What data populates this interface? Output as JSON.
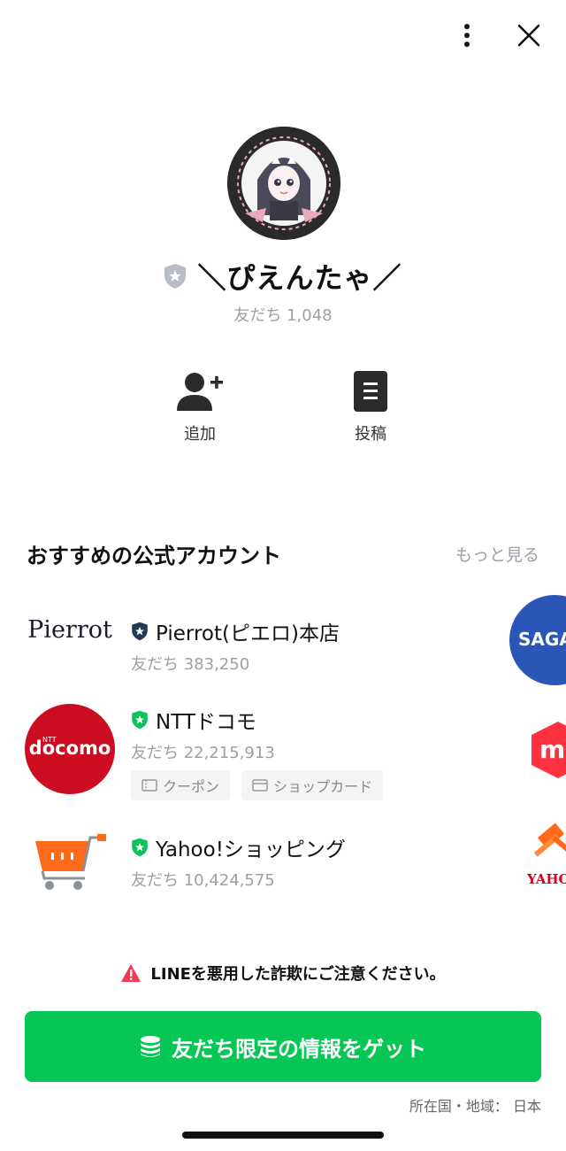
{
  "header": {
    "menu_icon": "more-vertical-icon",
    "close_icon": "close-icon"
  },
  "profile": {
    "badge_icon": "verified-shield-icon",
    "name": "＼ぴえんたゃ／",
    "friends_label": "友だち 1,048"
  },
  "actions": [
    {
      "label": "追加",
      "icon": "add-friend-icon"
    },
    {
      "label": "投稿",
      "icon": "post-document-icon"
    }
  ],
  "recommended": {
    "title": "おすすめの公式アカウント",
    "more": "もっと見る",
    "accounts": [
      {
        "logo_text": "Pierrot",
        "name": "Pierrot(ピエロ)本店",
        "friends": "友だち 383,250",
        "badge": "navy-shield-icon"
      },
      {
        "logo_text": "docomo",
        "logo_sup": "NTT",
        "name": "NTTドコモ",
        "friends": "友だち 22,215,913",
        "badge": "green-shield-icon",
        "chips": [
          {
            "label": "クーポン",
            "icon": "coupon-icon"
          },
          {
            "label": "ショップカード",
            "icon": "shop-card-icon"
          }
        ]
      },
      {
        "name": "Yahoo!ショッピング",
        "friends": "友だち 10,424,575",
        "badge": "green-shield-icon",
        "logo_icon": "shopping-cart-icon"
      }
    ],
    "side_logos": {
      "sagawa": "SAGAW",
      "mercari": "m",
      "yahoo": "YAHO"
    }
  },
  "warning": {
    "icon": "warning-triangle-icon",
    "text": "LINEを悪用した詐欺にご注意ください。"
  },
  "cta": {
    "icon": "coin-stack-icon",
    "label": "友だち限定の情報をゲット"
  },
  "footer": {
    "region": "所在国・地域： 日本"
  },
  "colors": {
    "line_green": "#06c755",
    "docomo_red": "#cc0d21",
    "sagawa_blue": "#2a57b7",
    "yahoo_orange": "#ff6a1a"
  }
}
